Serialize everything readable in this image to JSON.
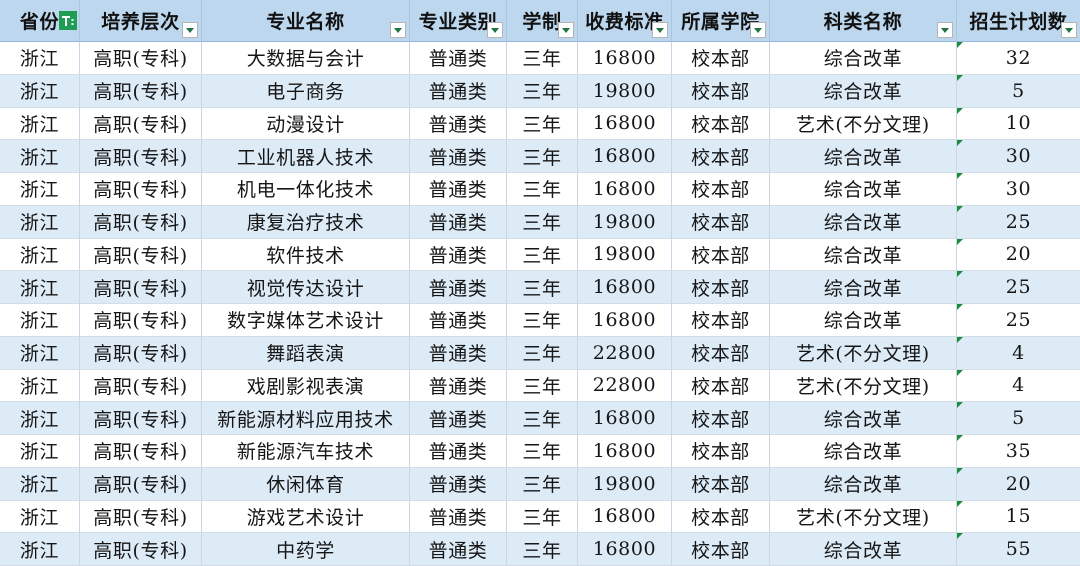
{
  "theme": {
    "header_bg": "#bdd7ee",
    "band_bg": "#ddebf7",
    "filter_green": "#1f9d55",
    "arrow_green": "#217346",
    "indicator_green": "#1e8c3e"
  },
  "sheet": {
    "headers": [
      {
        "label": "省份",
        "filter_icon": "filter-active-icon"
      },
      {
        "label": "培养层次",
        "filter_icon": "dropdown-arrow-icon"
      },
      {
        "label": "专业名称",
        "filter_icon": "dropdown-arrow-icon"
      },
      {
        "label": "专业类别",
        "filter_icon": "dropdown-arrow-icon"
      },
      {
        "label": "学制",
        "filter_icon": "dropdown-arrow-icon"
      },
      {
        "label": "收费标准",
        "filter_icon": "dropdown-arrow-icon"
      },
      {
        "label": "所属学院",
        "filter_icon": "dropdown-arrow-icon"
      },
      {
        "label": "科类名称",
        "filter_icon": "dropdown-arrow-icon"
      },
      {
        "label": "招生计划数",
        "filter_icon": "dropdown-arrow-icon"
      }
    ],
    "rows": [
      [
        "浙江",
        "高职(专科)",
        "大数据与会计",
        "普通类",
        "三年",
        "16800",
        "校本部",
        "综合改革",
        "32"
      ],
      [
        "浙江",
        "高职(专科)",
        "电子商务",
        "普通类",
        "三年",
        "19800",
        "校本部",
        "综合改革",
        "5"
      ],
      [
        "浙江",
        "高职(专科)",
        "动漫设计",
        "普通类",
        "三年",
        "16800",
        "校本部",
        "艺术(不分文理)",
        "10"
      ],
      [
        "浙江",
        "高职(专科)",
        "工业机器人技术",
        "普通类",
        "三年",
        "16800",
        "校本部",
        "综合改革",
        "30"
      ],
      [
        "浙江",
        "高职(专科)",
        "机电一体化技术",
        "普通类",
        "三年",
        "16800",
        "校本部",
        "综合改革",
        "30"
      ],
      [
        "浙江",
        "高职(专科)",
        "康复治疗技术",
        "普通类",
        "三年",
        "19800",
        "校本部",
        "综合改革",
        "25"
      ],
      [
        "浙江",
        "高职(专科)",
        "软件技术",
        "普通类",
        "三年",
        "19800",
        "校本部",
        "综合改革",
        "20"
      ],
      [
        "浙江",
        "高职(专科)",
        "视觉传达设计",
        "普通类",
        "三年",
        "16800",
        "校本部",
        "综合改革",
        "25"
      ],
      [
        "浙江",
        "高职(专科)",
        "数字媒体艺术设计",
        "普通类",
        "三年",
        "16800",
        "校本部",
        "综合改革",
        "25"
      ],
      [
        "浙江",
        "高职(专科)",
        "舞蹈表演",
        "普通类",
        "三年",
        "22800",
        "校本部",
        "艺术(不分文理)",
        "4"
      ],
      [
        "浙江",
        "高职(专科)",
        "戏剧影视表演",
        "普通类",
        "三年",
        "22800",
        "校本部",
        "艺术(不分文理)",
        "4"
      ],
      [
        "浙江",
        "高职(专科)",
        "新能源材料应用技术",
        "普通类",
        "三年",
        "16800",
        "校本部",
        "综合改革",
        "5"
      ],
      [
        "浙江",
        "高职(专科)",
        "新能源汽车技术",
        "普通类",
        "三年",
        "16800",
        "校本部",
        "综合改革",
        "35"
      ],
      [
        "浙江",
        "高职(专科)",
        "休闲体育",
        "普通类",
        "三年",
        "19800",
        "校本部",
        "综合改革",
        "20"
      ],
      [
        "浙江",
        "高职(专科)",
        "游戏艺术设计",
        "普通类",
        "三年",
        "16800",
        "校本部",
        "艺术(不分文理)",
        "15"
      ],
      [
        "浙江",
        "高职(专科)",
        "中药学",
        "普通类",
        "三年",
        "16800",
        "校本部",
        "综合改革",
        "55"
      ]
    ]
  }
}
